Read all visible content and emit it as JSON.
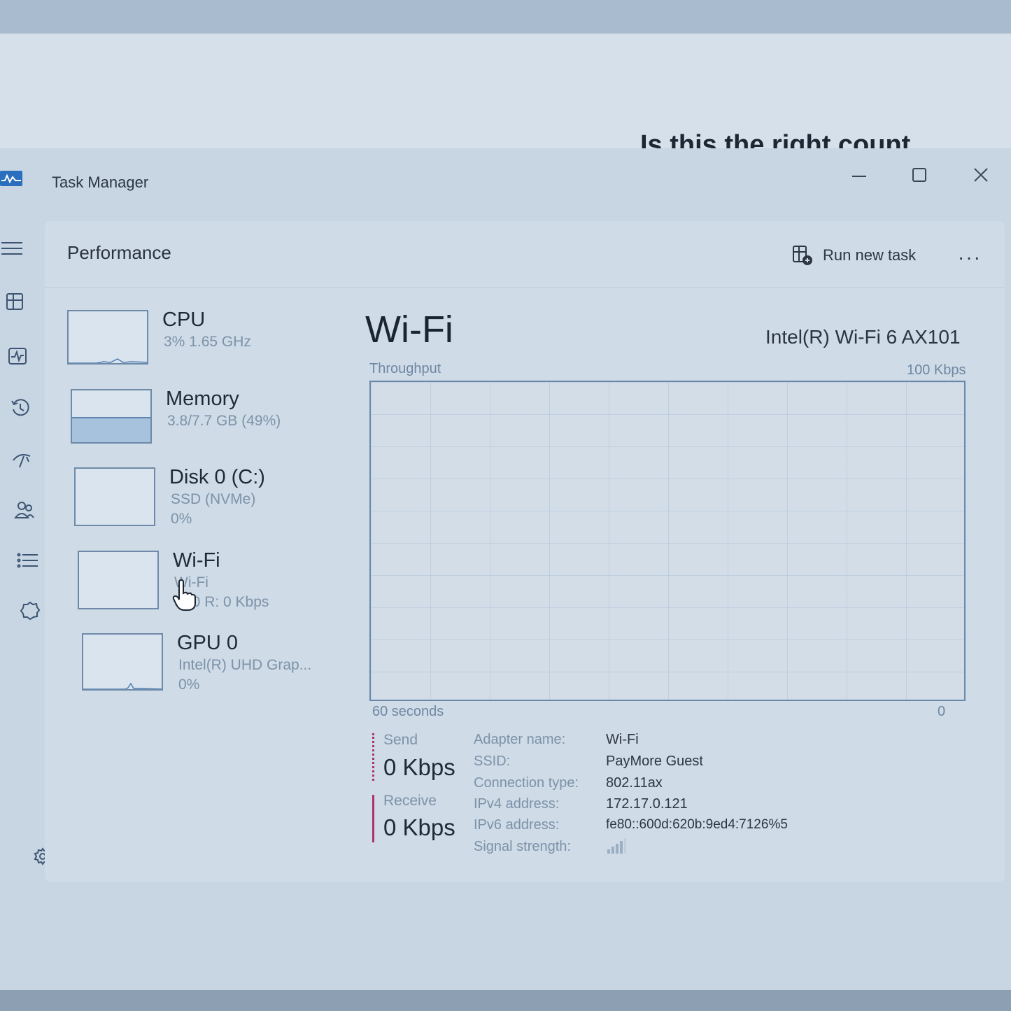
{
  "background": {
    "heading": "Is this the right count"
  },
  "window": {
    "title": "Task Manager"
  },
  "header": {
    "page_title": "Performance",
    "run_new_task": "Run new task",
    "more": "···"
  },
  "resources": [
    {
      "name": "CPU",
      "sub": "3%  1.65 GHz",
      "sub2": ""
    },
    {
      "name": "Memory",
      "sub": "3.8/7.7 GB (49%)",
      "sub2": ""
    },
    {
      "name": "Disk 0 (C:)",
      "sub": "SSD (NVMe)",
      "sub2": "0%"
    },
    {
      "name": "Wi-Fi",
      "sub": "Wi-Fi",
      "sub2": "S: 0 R: 0 Kbps"
    },
    {
      "name": "GPU 0",
      "sub": "Intel(R) UHD Grap...",
      "sub2": "0%"
    }
  ],
  "detail": {
    "title": "Wi-Fi",
    "adapter": "Intel(R) Wi-Fi 6 AX101",
    "graph": {
      "label": "Throughput",
      "max": "100 Kbps",
      "time_span": "60 seconds",
      "min": "0"
    },
    "send_label": "Send",
    "send_value": "0 Kbps",
    "receive_label": "Receive",
    "receive_value": "0 Kbps",
    "properties": [
      {
        "label": "Adapter name:",
        "value": "Wi-Fi"
      },
      {
        "label": "SSID:",
        "value": "PayMore Guest"
      },
      {
        "label": "Connection type:",
        "value": "802.11ax"
      },
      {
        "label": "IPv4 address:",
        "value": "172.17.0.121"
      },
      {
        "label": "IPv6 address:",
        "value": "fe80::600d:620b:9ed4:7126%5"
      },
      {
        "label": "Signal strength:",
        "value": ""
      }
    ]
  },
  "metrics": {
    "memory_fill_fraction": 0.49
  },
  "colors": {
    "accent": "#2b6fc0",
    "send_line": "#b0306a",
    "receive_line": "#b0306a"
  }
}
